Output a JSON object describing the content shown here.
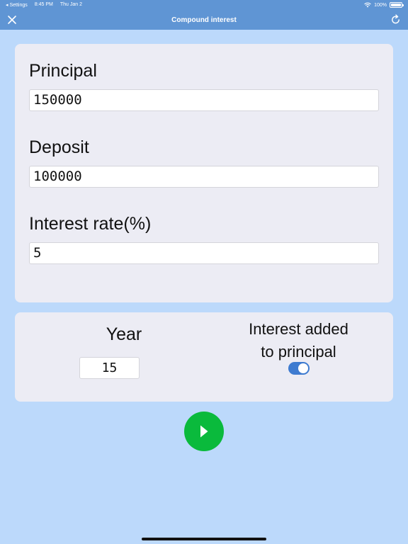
{
  "status_bar": {
    "back_app": "◂ Settings",
    "time": "8:45 PM",
    "date": "Thu Jan 2",
    "battery": "100%"
  },
  "nav": {
    "title": "Compound interest",
    "close_icon": "close-icon",
    "refresh_icon": "refresh-icon"
  },
  "form": {
    "principal_label": "Principal",
    "principal_value": "150000",
    "deposit_label": "Deposit",
    "deposit_value": "100000",
    "rate_label": "Interest rate(%)",
    "rate_value": "5"
  },
  "options": {
    "year_label": "Year",
    "year_value": "15",
    "interest_label_line1": "Interest added",
    "interest_label_line2": "to principal",
    "interest_added_on": true
  },
  "actions": {
    "play_icon": "play-icon"
  },
  "colors": {
    "background": "#bcd9fb",
    "nav_bar": "#5f95d4",
    "card": "#ececf4",
    "play_button": "#0aba3c",
    "toggle_on": "#3e7bd0"
  }
}
